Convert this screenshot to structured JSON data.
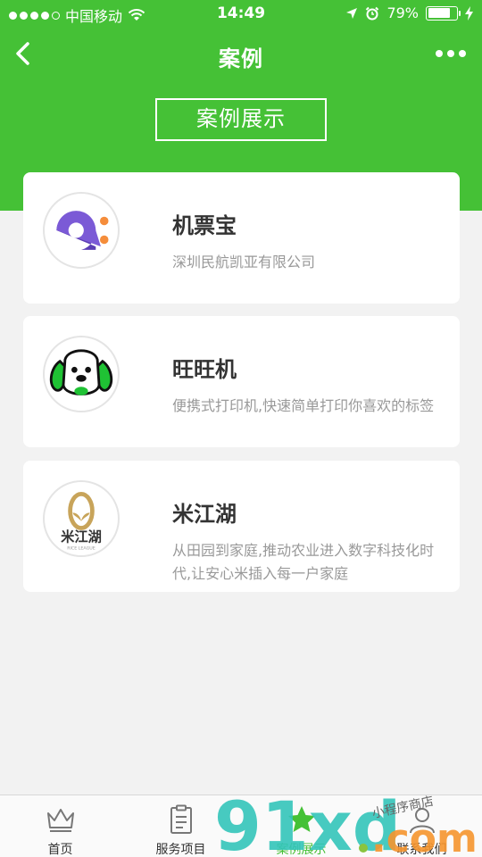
{
  "status_bar": {
    "carrier": "中国移动",
    "time": "14:49",
    "battery_percent": "79%",
    "battery_level": 0.79
  },
  "nav": {
    "title": "案例"
  },
  "section_title": "案例展示",
  "cases": [
    {
      "name": "机票宝",
      "desc": "深圳民航凯亚有限公司",
      "logo": "plane-ticket-pin-logo"
    },
    {
      "name": "旺旺机",
      "desc": "便携式打印机,快速简单打印你喜欢的标签",
      "logo": "puppy-face-logo"
    },
    {
      "name": "米江湖",
      "desc": "从田园到家庭,推动农业进入数字科技化时代,让安心米插入每一户家庭",
      "logo": "rice-seed-logo",
      "logo_text": "米江湖",
      "logo_subtext": "RICE LEAGUE"
    }
  ],
  "tabs": [
    {
      "label": "首页",
      "icon": "crown-icon",
      "active": false
    },
    {
      "label": "服务项目",
      "icon": "clipboard-icon",
      "active": false
    },
    {
      "label": "案例展示",
      "icon": "star-icon",
      "active": true
    },
    {
      "label": "联系我们",
      "icon": "contact-icon",
      "active": false
    }
  ],
  "watermark": {
    "text": "91xd",
    "domain": ".com",
    "tagline": "小程序商店"
  },
  "colors": {
    "brand_green": "#45c136",
    "logo_purple": "#6c4fc7",
    "logo_orange": "#f58d3b",
    "rice_gold": "#c8a45a"
  }
}
